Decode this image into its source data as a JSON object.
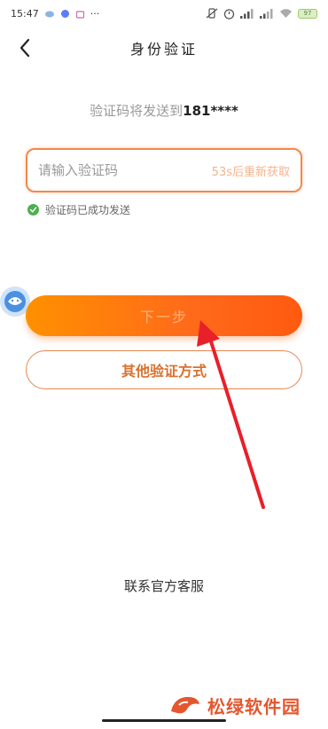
{
  "status_bar": {
    "time": "15:47",
    "more": "···",
    "battery": "97"
  },
  "header": {
    "title": "身份验证"
  },
  "notice": {
    "prefix": "验证码将发送到",
    "phone": "181****"
  },
  "code_input": {
    "placeholder": "请输入验证码",
    "value": "",
    "resend_label": "53s后重新获取"
  },
  "success": {
    "text": "验证码已成功发送"
  },
  "buttons": {
    "next_label": "下一步",
    "other_methods_label": "其他验证方式"
  },
  "service": {
    "label": "联系官方客服"
  },
  "watermark": {
    "text": "松绿软件园"
  },
  "colors": {
    "accent": "#ff6a1a",
    "border": "#f08a4c",
    "success": "#4caf50",
    "arrow": "#e8202a"
  }
}
